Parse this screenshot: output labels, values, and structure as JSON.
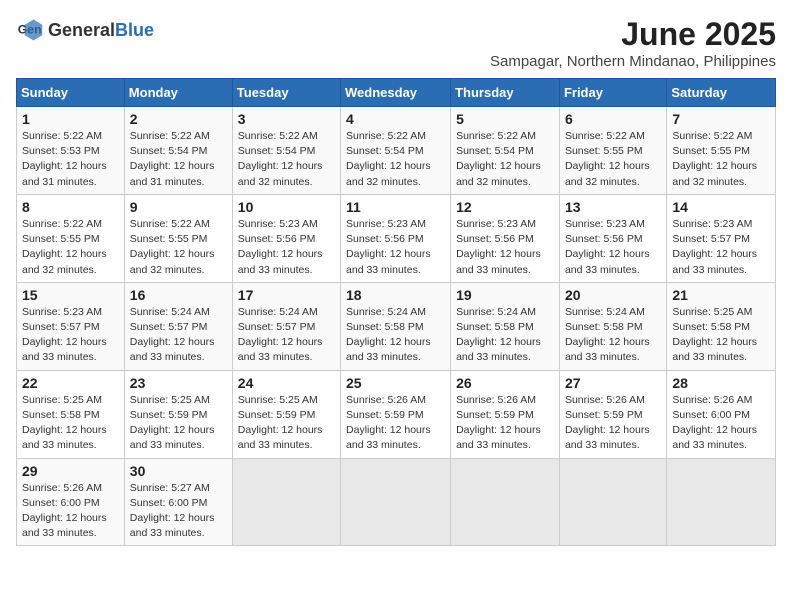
{
  "logo": {
    "general": "General",
    "blue": "Blue"
  },
  "title": "June 2025",
  "subtitle": "Sampagar, Northern Mindanao, Philippines",
  "weekdays": [
    "Sunday",
    "Monday",
    "Tuesday",
    "Wednesday",
    "Thursday",
    "Friday",
    "Saturday"
  ],
  "weeks": [
    [
      {
        "day": "1",
        "info": "Sunrise: 5:22 AM\nSunset: 5:53 PM\nDaylight: 12 hours\nand 31 minutes."
      },
      {
        "day": "2",
        "info": "Sunrise: 5:22 AM\nSunset: 5:54 PM\nDaylight: 12 hours\nand 31 minutes."
      },
      {
        "day": "3",
        "info": "Sunrise: 5:22 AM\nSunset: 5:54 PM\nDaylight: 12 hours\nand 32 minutes."
      },
      {
        "day": "4",
        "info": "Sunrise: 5:22 AM\nSunset: 5:54 PM\nDaylight: 12 hours\nand 32 minutes."
      },
      {
        "day": "5",
        "info": "Sunrise: 5:22 AM\nSunset: 5:54 PM\nDaylight: 12 hours\nand 32 minutes."
      },
      {
        "day": "6",
        "info": "Sunrise: 5:22 AM\nSunset: 5:55 PM\nDaylight: 12 hours\nand 32 minutes."
      },
      {
        "day": "7",
        "info": "Sunrise: 5:22 AM\nSunset: 5:55 PM\nDaylight: 12 hours\nand 32 minutes."
      }
    ],
    [
      {
        "day": "8",
        "info": "Sunrise: 5:22 AM\nSunset: 5:55 PM\nDaylight: 12 hours\nand 32 minutes."
      },
      {
        "day": "9",
        "info": "Sunrise: 5:22 AM\nSunset: 5:55 PM\nDaylight: 12 hours\nand 32 minutes."
      },
      {
        "day": "10",
        "info": "Sunrise: 5:23 AM\nSunset: 5:56 PM\nDaylight: 12 hours\nand 33 minutes."
      },
      {
        "day": "11",
        "info": "Sunrise: 5:23 AM\nSunset: 5:56 PM\nDaylight: 12 hours\nand 33 minutes."
      },
      {
        "day": "12",
        "info": "Sunrise: 5:23 AM\nSunset: 5:56 PM\nDaylight: 12 hours\nand 33 minutes."
      },
      {
        "day": "13",
        "info": "Sunrise: 5:23 AM\nSunset: 5:56 PM\nDaylight: 12 hours\nand 33 minutes."
      },
      {
        "day": "14",
        "info": "Sunrise: 5:23 AM\nSunset: 5:57 PM\nDaylight: 12 hours\nand 33 minutes."
      }
    ],
    [
      {
        "day": "15",
        "info": "Sunrise: 5:23 AM\nSunset: 5:57 PM\nDaylight: 12 hours\nand 33 minutes."
      },
      {
        "day": "16",
        "info": "Sunrise: 5:24 AM\nSunset: 5:57 PM\nDaylight: 12 hours\nand 33 minutes."
      },
      {
        "day": "17",
        "info": "Sunrise: 5:24 AM\nSunset: 5:57 PM\nDaylight: 12 hours\nand 33 minutes."
      },
      {
        "day": "18",
        "info": "Sunrise: 5:24 AM\nSunset: 5:58 PM\nDaylight: 12 hours\nand 33 minutes."
      },
      {
        "day": "19",
        "info": "Sunrise: 5:24 AM\nSunset: 5:58 PM\nDaylight: 12 hours\nand 33 minutes."
      },
      {
        "day": "20",
        "info": "Sunrise: 5:24 AM\nSunset: 5:58 PM\nDaylight: 12 hours\nand 33 minutes."
      },
      {
        "day": "21",
        "info": "Sunrise: 5:25 AM\nSunset: 5:58 PM\nDaylight: 12 hours\nand 33 minutes."
      }
    ],
    [
      {
        "day": "22",
        "info": "Sunrise: 5:25 AM\nSunset: 5:58 PM\nDaylight: 12 hours\nand 33 minutes."
      },
      {
        "day": "23",
        "info": "Sunrise: 5:25 AM\nSunset: 5:59 PM\nDaylight: 12 hours\nand 33 minutes."
      },
      {
        "day": "24",
        "info": "Sunrise: 5:25 AM\nSunset: 5:59 PM\nDaylight: 12 hours\nand 33 minutes."
      },
      {
        "day": "25",
        "info": "Sunrise: 5:26 AM\nSunset: 5:59 PM\nDaylight: 12 hours\nand 33 minutes."
      },
      {
        "day": "26",
        "info": "Sunrise: 5:26 AM\nSunset: 5:59 PM\nDaylight: 12 hours\nand 33 minutes."
      },
      {
        "day": "27",
        "info": "Sunrise: 5:26 AM\nSunset: 5:59 PM\nDaylight: 12 hours\nand 33 minutes."
      },
      {
        "day": "28",
        "info": "Sunrise: 5:26 AM\nSunset: 6:00 PM\nDaylight: 12 hours\nand 33 minutes."
      }
    ],
    [
      {
        "day": "29",
        "info": "Sunrise: 5:26 AM\nSunset: 6:00 PM\nDaylight: 12 hours\nand 33 minutes."
      },
      {
        "day": "30",
        "info": "Sunrise: 5:27 AM\nSunset: 6:00 PM\nDaylight: 12 hours\nand 33 minutes."
      },
      null,
      null,
      null,
      null,
      null
    ]
  ]
}
